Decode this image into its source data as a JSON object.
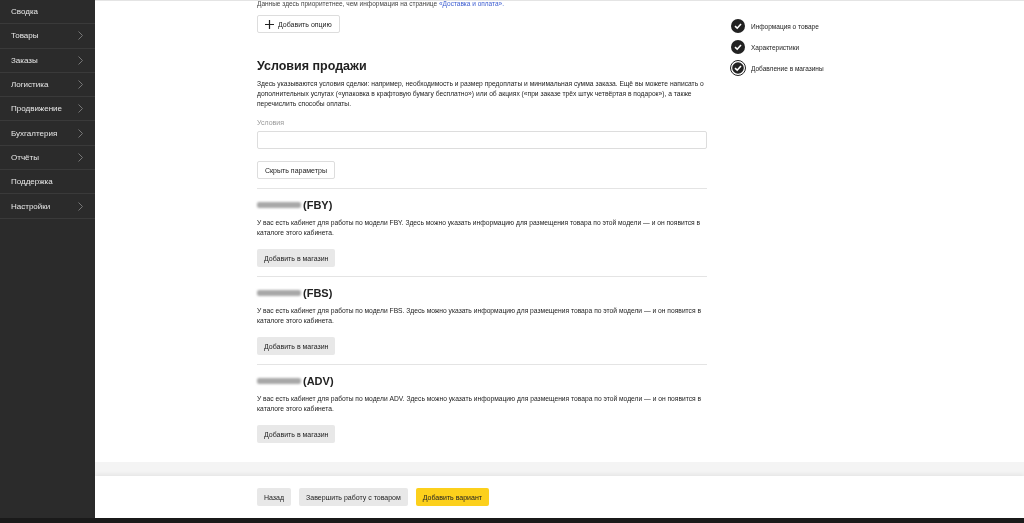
{
  "sidebar": {
    "items": [
      {
        "label": "Сводка",
        "has_submenu": false
      },
      {
        "label": "Товары",
        "has_submenu": true
      },
      {
        "label": "Заказы",
        "has_submenu": true
      },
      {
        "label": "Логистика",
        "has_submenu": true
      },
      {
        "label": "Продвижение",
        "has_submenu": true
      },
      {
        "label": "Бухгалтерия",
        "has_submenu": true
      },
      {
        "label": "Отчёты",
        "has_submenu": true
      },
      {
        "label": "Поддержка",
        "has_submenu": false
      },
      {
        "label": "Настройки",
        "has_submenu": true
      }
    ]
  },
  "top_note": {
    "text": "Данные здесь приоритетнее, чем информация на странице",
    "link": "«Доставка и оплата»."
  },
  "add_option_button": "Добавить опцию",
  "sale_conditions": {
    "title": "Условия продажи",
    "description": "Здесь указываются условия сделки: например, необходимость и размер предоплаты и минимальная сумма заказа. Ещё вы можете написать о дополнительных услугах («упаковка в крафтовую бумагу бесплатно») или об акциях («при заказе трёх штук четвёртая в подарок»), а также перечислить способы оплаты.",
    "field_label": "Условия",
    "hide_button": "Скрыть параметры"
  },
  "stores": [
    {
      "model": "(FBY)",
      "description": "У вас есть кабинет для работы по модели FBY. Здесь можно указать информацию для размещения товара по этой модели — и он появится в каталоге этого кабинета.",
      "button": "Добавить в магазин"
    },
    {
      "model": "(FBS)",
      "description": "У вас есть кабинет для работы по модели FBS. Здесь можно указать информацию для размещения товара по этой модели — и он появится в каталоге этого кабинета.",
      "button": "Добавить в магазин"
    },
    {
      "model": "(ADV)",
      "description": "У вас есть кабинет для работы по модели ADV. Здесь можно указать информацию для размещения товара по этой модели — и он появится в каталоге этого кабинета.",
      "button": "Добавить в магазин"
    }
  ],
  "steps": [
    {
      "label": "Информация о товаре",
      "selected": false
    },
    {
      "label": "Характеристики",
      "selected": false
    },
    {
      "label": "Добавление в магазины",
      "selected": true
    }
  ],
  "footer": {
    "buttons": [
      {
        "label": "Назад",
        "kind": "secondary"
      },
      {
        "label": "Завершить работу с товаром",
        "kind": "secondary"
      },
      {
        "label": "Добавить вариант",
        "kind": "primary"
      }
    ]
  }
}
